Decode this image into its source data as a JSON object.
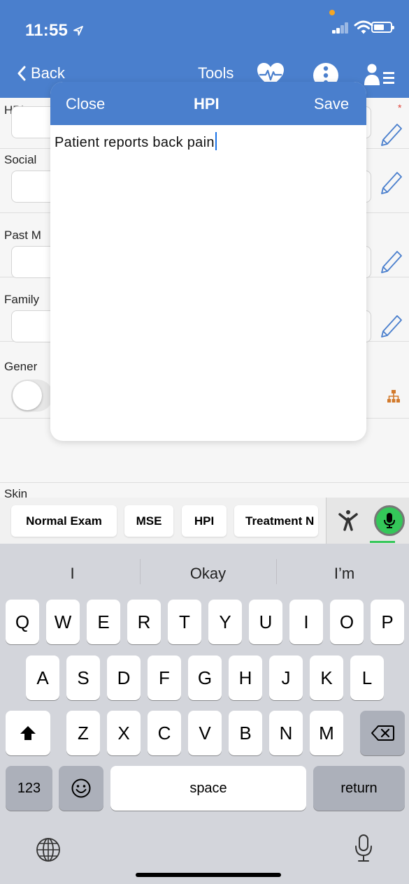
{
  "status_bar": {
    "time": "11:55"
  },
  "nav": {
    "back_label": "Back",
    "tools_label": "Tools",
    "icons": [
      "heart-monitor-icon",
      "more-icon",
      "patient-list-icon"
    ]
  },
  "form": {
    "rows": [
      {
        "label": "HPI",
        "required_mark": "*"
      },
      {
        "label": "Social"
      },
      {
        "label": "Past M"
      },
      {
        "label": "Family"
      },
      {
        "label": "Gener"
      },
      {
        "label": "Skin"
      }
    ]
  },
  "modal": {
    "close_label": "Close",
    "title": "HPI",
    "save_label": "Save",
    "text": "Patient reports back pain"
  },
  "suggestions": {
    "chips": [
      "Normal Exam",
      "MSE",
      "HPI",
      "Treatment N"
    ]
  },
  "keyboard": {
    "predictions": [
      "I",
      "Okay",
      "I’m"
    ],
    "row1": [
      "Q",
      "W",
      "E",
      "R",
      "T",
      "Y",
      "U",
      "I",
      "O",
      "P"
    ],
    "row2": [
      "A",
      "S",
      "D",
      "F",
      "G",
      "H",
      "J",
      "K",
      "L"
    ],
    "row3": [
      "Z",
      "X",
      "C",
      "V",
      "B",
      "N",
      "M"
    ],
    "numbers_label": "123",
    "space_label": "space",
    "return_label": "return"
  },
  "colors": {
    "accent": "#4a7fcd",
    "pencil": "#4a7fcd",
    "required": "#e0443a",
    "hierarchy_icon": "#d27a2c",
    "mic_green": "#34c759"
  }
}
